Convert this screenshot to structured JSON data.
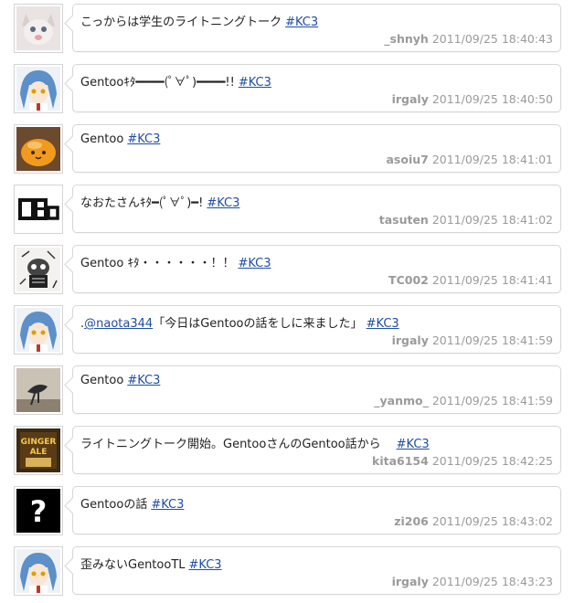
{
  "tweets": [
    {
      "text": "こっからは学生のライトニングトーク",
      "pre_mention": "",
      "mention": "",
      "post_mention": "",
      "hashtag": "#KC3",
      "user": "_shnyh",
      "time": "2011/09/25 18:40:43",
      "avatar": "cat-photo"
    },
    {
      "text": "Gentooｷﾀ━━━━(ﾟ∀ﾟ)━━━━!!",
      "pre_mention": "",
      "mention": "",
      "post_mention": "",
      "hashtag": "#KC3",
      "user": "irgaly",
      "time": "2011/09/25 18:40:50",
      "avatar": "anime-girl-blue-hair"
    },
    {
      "text": "Gentoo",
      "pre_mention": "",
      "mention": "",
      "post_mention": "",
      "hashtag": "#KC3",
      "user": "asoiu7",
      "time": "2011/09/25 18:41:01",
      "avatar": "orange-bun"
    },
    {
      "text": "なおたさんｷﾀ━(ﾟ∀ﾟ)━!",
      "pre_mention": "",
      "mention": "",
      "post_mention": "",
      "hashtag": "#KC3",
      "user": "tasuten",
      "time": "2011/09/25 18:41:02",
      "avatar": "pixel-logo"
    },
    {
      "text": "Gentoo ｷﾀ・・・・・・！！",
      "pre_mention": "",
      "mention": "",
      "post_mention": "",
      "hashtag": "#KC3",
      "user": "TC002",
      "time": "2011/09/25 18:41:41",
      "avatar": "ink-drawing"
    },
    {
      "text": "",
      "pre_mention": ".",
      "mention": "@naota344",
      "post_mention": "「今日はGentooの話をしに来ました」 ",
      "hashtag": "#KC3",
      "user": "irgaly",
      "time": "2011/09/25 18:41:59",
      "avatar": "anime-girl-blue-hair"
    },
    {
      "text": "Gentoo",
      "pre_mention": "",
      "mention": "",
      "post_mention": "",
      "hashtag": "#KC3",
      "user": "_yanmo_",
      "time": "2011/09/25 18:41:59",
      "avatar": "bird-photo"
    },
    {
      "text": "ライトニングトーク開始。GentooさんのGentoo話から　",
      "pre_mention": "",
      "mention": "",
      "post_mention": "",
      "hashtag": "#KC3",
      "user": "kita6154",
      "time": "2011/09/25 18:42:25",
      "avatar": "ginger-ale"
    },
    {
      "text": "Gentooの話",
      "pre_mention": "",
      "mention": "",
      "post_mention": "",
      "hashtag": "#KC3",
      "user": "zi206",
      "time": "2011/09/25 18:43:02",
      "avatar": "question-mark"
    },
    {
      "text": "歪みないGentooTL",
      "pre_mention": "",
      "mention": "",
      "post_mention": "",
      "hashtag": "#KC3",
      "user": "irgaly",
      "time": "2011/09/25 18:43:23",
      "avatar": "anime-girl-blue-hair"
    }
  ],
  "avatar_text": {
    "pixel_logo": "OAo",
    "ginger_ale": "GINGER ALE",
    "question": "?"
  },
  "colors": {
    "link": "#1f4ea1",
    "meta": "#9a9a9a",
    "border": "#d6d6d6"
  }
}
